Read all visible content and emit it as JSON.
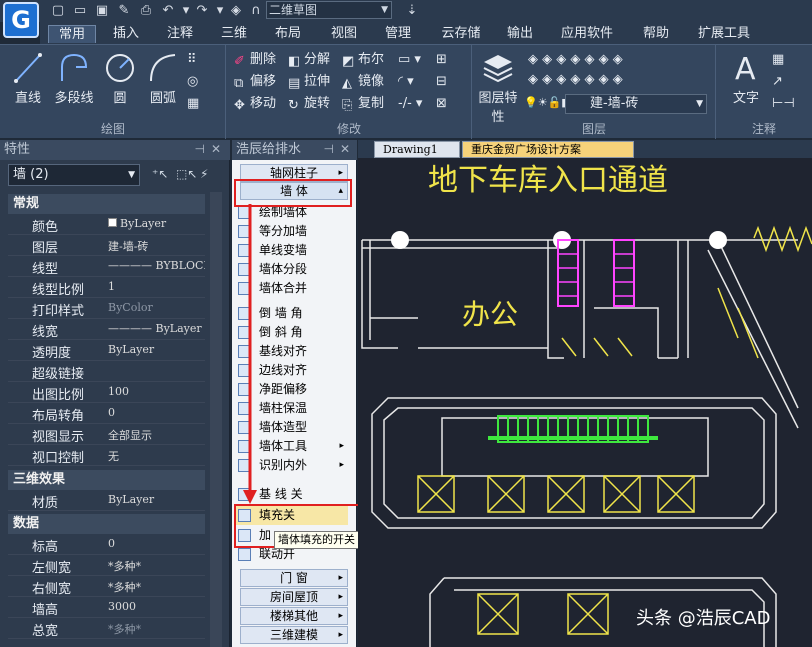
{
  "app": {
    "logo_letter": "G",
    "drawing_combo": "二维草图"
  },
  "menu": [
    "常用",
    "插入",
    "注释",
    "三维",
    "布局",
    "视图",
    "管理",
    "云存储",
    "输出",
    "应用软件",
    "帮助",
    "扩展工具"
  ],
  "ribbon": {
    "draw": {
      "line": "直线",
      "polyline": "多段线",
      "circle": "圆",
      "arc": "圆弧",
      "label": "绘图"
    },
    "modify": {
      "erase": "删除",
      "explode": "分解",
      "boolean": "布尔",
      "offset": "偏移",
      "stretch": "拉伸",
      "mirror": "镜像",
      "move": "移动",
      "rotate": "旋转",
      "copy": "复制",
      "label": "修改"
    },
    "layer": {
      "props": "图层特性",
      "current": "建-墙-砖",
      "label": "图层"
    },
    "annotate": {
      "text": "文字",
      "label": "注释"
    }
  },
  "props": {
    "title": "特性",
    "selector": "墙 (2)",
    "sections": {
      "general": "常规",
      "three_d": "三维效果",
      "data": "数据"
    },
    "general": [
      {
        "k": "颜色",
        "v": "ByLayer"
      },
      {
        "k": "图层",
        "v": "建-墙-砖"
      },
      {
        "k": "线型",
        "v": "———— BYBLOCK"
      },
      {
        "k": "线型比例",
        "v": "1"
      },
      {
        "k": "打印样式",
        "v": "ByColor"
      },
      {
        "k": "线宽",
        "v": "———— ByLayer"
      },
      {
        "k": "透明度",
        "v": "ByLayer"
      },
      {
        "k": "超级链接",
        "v": ""
      },
      {
        "k": "出图比例",
        "v": "100"
      },
      {
        "k": "布局转角",
        "v": "0"
      },
      {
        "k": "视图显示",
        "v": "全部显示"
      },
      {
        "k": "视口控制",
        "v": "无"
      }
    ],
    "three_d": [
      {
        "k": "材质",
        "v": "ByLayer"
      }
    ],
    "data": [
      {
        "k": "标高",
        "v": "0"
      },
      {
        "k": "左侧宽",
        "v": "*多种*"
      },
      {
        "k": "右侧宽",
        "v": "*多种*"
      },
      {
        "k": "墙高",
        "v": "3000"
      },
      {
        "k": "总宽",
        "v": "*多种*"
      }
    ]
  },
  "tool": {
    "title": "浩辰给排水",
    "axis": "轴网柱子",
    "wall": "墙    体",
    "items": [
      "绘制墙体",
      "等分加墙",
      "单线变墙",
      "墙体分段",
      "墙体合并",
      "倒 墙 角",
      "倒 斜 角",
      "基线对齐",
      "边线对齐",
      "净距偏移",
      "墙柱保温",
      "墙体造型",
      "墙体工具",
      "识别内外",
      "基 线 关",
      "填充关",
      "加",
      "联动开"
    ],
    "door": "门    窗",
    "room": "房间屋顶",
    "stairs": "楼梯其他",
    "model3d": "三维建模",
    "tooltip": "墙体填充的开关"
  },
  "canvas": {
    "tabs": [
      "Drawing1",
      "重庆金贸广场设计方案"
    ],
    "title_text": "地下车库入口通道",
    "room_text": "办公"
  },
  "watermark": "头条 @浩辰CAD"
}
